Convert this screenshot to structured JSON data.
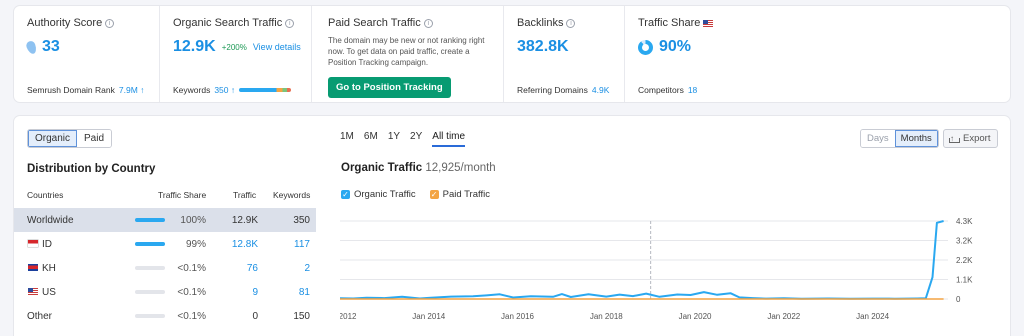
{
  "metrics": {
    "authority": {
      "title": "Authority Score",
      "value": "33",
      "foot_label": "Semrush Domain Rank",
      "foot_value": "7.9M ↑"
    },
    "organic": {
      "title": "Organic Search Traffic",
      "value": "12.9K",
      "delta": "+200%",
      "link": "View details",
      "foot_label": "Keywords",
      "foot_value": "350 ↑"
    },
    "paid": {
      "title": "Paid Search Traffic",
      "description": "The domain may be new or not ranking right now. To get data on paid traffic, create a Position Tracking campaign.",
      "button": "Go to Position Tracking"
    },
    "backlinks": {
      "title": "Backlinks",
      "value": "382.8K",
      "foot_label": "Referring Domains",
      "foot_value": "4.9K"
    },
    "share": {
      "title": "Traffic Share",
      "value": "90%",
      "share_fraction": 0.9,
      "foot_label": "Competitors",
      "foot_value": "18"
    }
  },
  "tabs": [
    "Organic",
    "Paid"
  ],
  "distribution": {
    "title": "Distribution by Country",
    "headers": [
      "Countries",
      "Traffic Share",
      "Traffic",
      "Keywords"
    ],
    "rows": [
      {
        "country": "Worldwide",
        "flag": "",
        "share_fraction": 1.0,
        "share": "100%",
        "traffic": "12.9K",
        "keywords": "350",
        "selected": true,
        "linked": false
      },
      {
        "country": "ID",
        "flag": "id",
        "share_fraction": 0.99,
        "share": "99%",
        "traffic": "12.8K",
        "keywords": "117",
        "selected": false,
        "linked": true
      },
      {
        "country": "KH",
        "flag": "kh",
        "share_fraction": 0.0,
        "share": "<0.1%",
        "traffic": "76",
        "keywords": "2",
        "selected": false,
        "linked": true
      },
      {
        "country": "US",
        "flag": "us",
        "share_fraction": 0.0,
        "share": "<0.1%",
        "traffic": "9",
        "keywords": "81",
        "selected": false,
        "linked": true
      },
      {
        "country": "Other",
        "flag": "",
        "share_fraction": 0.0,
        "share": "<0.1%",
        "traffic": "0",
        "keywords": "150",
        "selected": false,
        "linked": false
      }
    ]
  },
  "ranges": [
    "1M",
    "6M",
    "1Y",
    "2Y",
    "All time"
  ],
  "active_range": "All time",
  "granularity": [
    "Days",
    "Months"
  ],
  "export_label": "Export",
  "chart_title": "Organic Traffic",
  "chart_subtitle": "12,925/month",
  "legend": [
    {
      "label": "Organic Traffic",
      "color": "#2aa8f0"
    },
    {
      "label": "Paid Traffic",
      "color": "#f3a443"
    }
  ],
  "colors": {
    "accent": "#1a8fe3",
    "cta": "#079b72",
    "organic": "#2aa8f0",
    "paid": "#f3a443"
  },
  "chart_data": {
    "type": "line",
    "x_tick_labels": [
      "Jan 2012",
      "Jan 2014",
      "Jan 2016",
      "Jan 2018",
      "Jan 2020",
      "Jan 2022",
      "Jan 2024"
    ],
    "y_tick_labels": [
      "4.3K",
      "3.2K",
      "2.2K",
      "1.1K",
      "0"
    ],
    "x_range": [
      2012.0,
      2025.7
    ],
    "ylim": [
      0,
      4300
    ],
    "series": [
      {
        "name": "Organic Traffic",
        "points": [
          [
            2012.0,
            40
          ],
          [
            2012.3,
            25
          ],
          [
            2012.6,
            70
          ],
          [
            2013.0,
            50
          ],
          [
            2013.4,
            120
          ],
          [
            2013.8,
            30
          ],
          [
            2014.0,
            60
          ],
          [
            2014.5,
            130
          ],
          [
            2015.0,
            150
          ],
          [
            2015.3,
            200
          ],
          [
            2015.6,
            260
          ],
          [
            2015.9,
            80
          ],
          [
            2016.3,
            150
          ],
          [
            2016.8,
            120
          ],
          [
            2017.0,
            270
          ],
          [
            2017.2,
            110
          ],
          [
            2017.6,
            260
          ],
          [
            2018.0,
            130
          ],
          [
            2018.3,
            240
          ],
          [
            2018.6,
            160
          ],
          [
            2018.9,
            300
          ],
          [
            2019.2,
            120
          ],
          [
            2019.6,
            250
          ],
          [
            2019.9,
            220
          ],
          [
            2020.2,
            380
          ],
          [
            2020.5,
            230
          ],
          [
            2020.8,
            320
          ],
          [
            2021.0,
            90
          ],
          [
            2021.3,
            50
          ],
          [
            2021.6,
            20
          ],
          [
            2022.0,
            40
          ],
          [
            2022.4,
            15
          ],
          [
            2023.0,
            30
          ],
          [
            2023.5,
            10
          ],
          [
            2024.0,
            20
          ],
          [
            2024.5,
            15
          ],
          [
            2025.0,
            30
          ],
          [
            2025.2,
            40
          ],
          [
            2025.35,
            1200
          ],
          [
            2025.45,
            4200
          ],
          [
            2025.6,
            4300
          ]
        ]
      },
      {
        "name": "Paid Traffic",
        "points": [
          [
            2012.0,
            0
          ],
          [
            2025.6,
            0
          ]
        ]
      }
    ],
    "marker_x": 2019.0
  }
}
